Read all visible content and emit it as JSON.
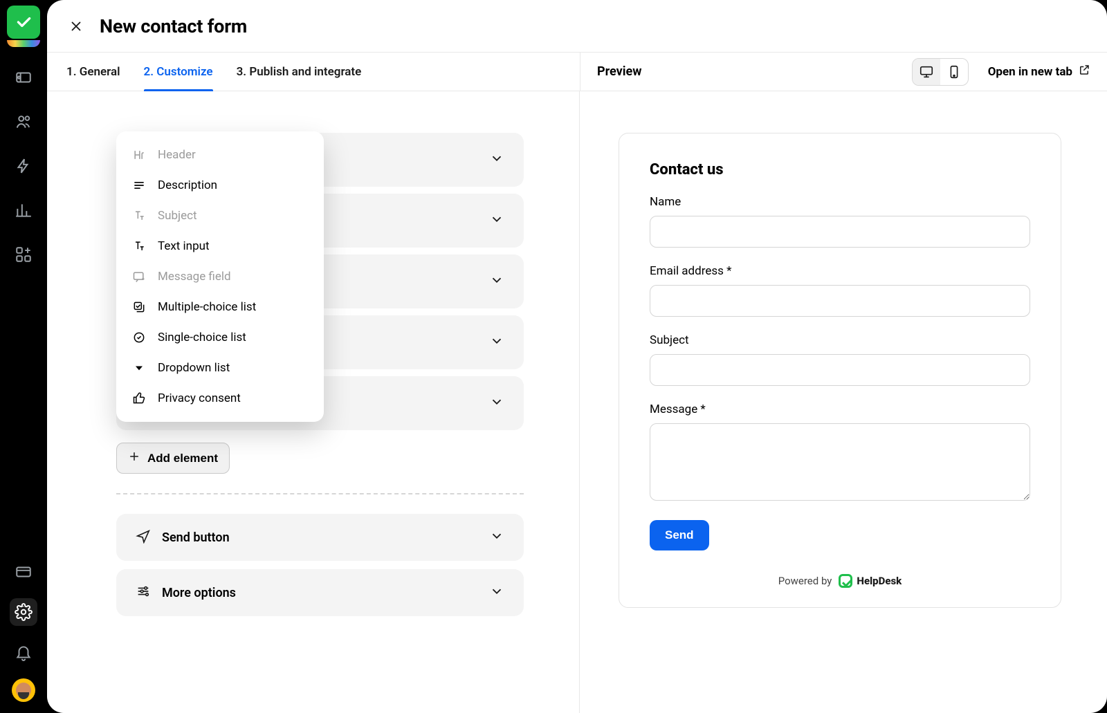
{
  "header": {
    "title": "New contact form"
  },
  "tabs": [
    {
      "label": "1. General"
    },
    {
      "label": "2. Customize"
    },
    {
      "label": "3. Publish and integrate"
    }
  ],
  "preview": {
    "label": "Preview",
    "open_new_tab": "Open in new tab"
  },
  "elements_menu": {
    "items": [
      {
        "label": "Header",
        "disabled": true
      },
      {
        "label": "Description",
        "disabled": false
      },
      {
        "label": "Subject",
        "disabled": true
      },
      {
        "label": "Text input",
        "disabled": false
      },
      {
        "label": "Message field",
        "disabled": true
      },
      {
        "label": "Multiple-choice list",
        "disabled": false
      },
      {
        "label": "Single-choice list",
        "disabled": false
      },
      {
        "label": "Dropdown list",
        "disabled": false
      },
      {
        "label": "Privacy consent",
        "disabled": false
      }
    ]
  },
  "left_panel": {
    "add_element": "Add element",
    "send_button_card": "Send button",
    "more_options_card": "More options"
  },
  "form_preview": {
    "title": "Contact us",
    "fields": {
      "name": {
        "label": "Name"
      },
      "email": {
        "label": "Email address *"
      },
      "subject": {
        "label": "Subject"
      },
      "message": {
        "label": "Message *"
      }
    },
    "send": "Send",
    "powered_by": "Powered by",
    "brand": "HelpDesk"
  }
}
